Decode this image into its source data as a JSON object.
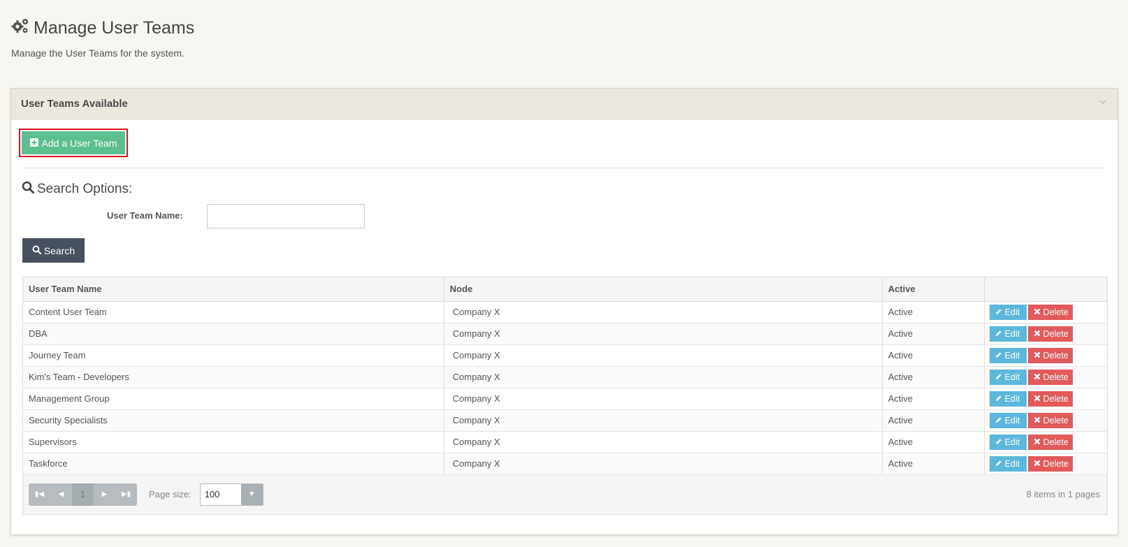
{
  "page": {
    "title": "Manage User Teams",
    "subtitle": "Manage the User Teams for the system.",
    "title_icon": "gears-icon"
  },
  "panel": {
    "title": "User Teams Available",
    "add_button_label": "Add a User Team",
    "highlight_color": "#e0141a"
  },
  "search": {
    "title": "Search Options:",
    "field_label": "User Team Name:",
    "field_value": "",
    "button_label": "Search"
  },
  "table": {
    "headers": [
      "User Team Name",
      "Node",
      "Active",
      ""
    ],
    "rows": [
      {
        "name": "Content User Team",
        "node": "Company X",
        "active": "Active"
      },
      {
        "name": "DBA",
        "node": "Company X",
        "active": "Active"
      },
      {
        "name": "Journey Team",
        "node": "Company X",
        "active": "Active"
      },
      {
        "name": "Kim's Team - Developers",
        "node": "Company X",
        "active": "Active"
      },
      {
        "name": "Management Group",
        "node": "Company X",
        "active": "Active"
      },
      {
        "name": "Security Specialists",
        "node": "Company X",
        "active": "Active"
      },
      {
        "name": "Supervisors",
        "node": "Company X",
        "active": "Active"
      },
      {
        "name": "Taskforce",
        "node": "Company X",
        "active": "Active"
      }
    ],
    "edit_label": "Edit",
    "delete_label": "Delete"
  },
  "pager": {
    "current_page": "1",
    "page_size_label": "Page size:",
    "page_size_value": "100",
    "info": "8 items in 1 pages"
  },
  "colors": {
    "add_button": "#5cbf8f",
    "search_button": "#46505e",
    "edit_button": "#5bb8dc",
    "delete_button": "#e35a5a"
  }
}
